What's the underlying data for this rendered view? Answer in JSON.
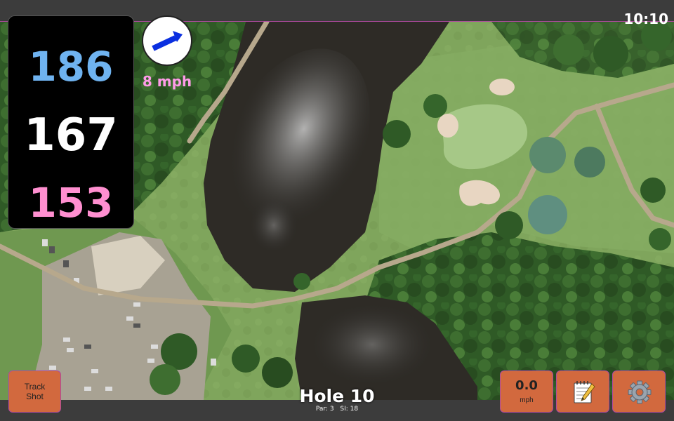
{
  "status_bar": {
    "time": "10:10"
  },
  "distances": {
    "back": "186",
    "middle": "167",
    "front": "153",
    "colors": {
      "back": "#6fb3f0",
      "middle": "#ffffff",
      "front": "#ff8fd0"
    }
  },
  "wind": {
    "speed_label": "8 mph",
    "icon": "wind-direction-arrow-icon",
    "arrow_color": "#0a2fe0"
  },
  "buttons": {
    "track_shot_line1": "Track",
    "track_shot_line2": "Shot",
    "speed_value": "0.0",
    "speed_unit": "mph",
    "notes_icon": "notepad-icon",
    "settings_icon": "gear-icon",
    "accent_color": "#d2693e"
  },
  "hole": {
    "title": "Hole 10",
    "par_label": "Par: 3",
    "si_label": "SI: 18"
  },
  "map": {
    "type": "satellite-aerial-view",
    "features": [
      "pond",
      "green",
      "bunkers",
      "cart-path",
      "parking-lot",
      "trees"
    ]
  }
}
